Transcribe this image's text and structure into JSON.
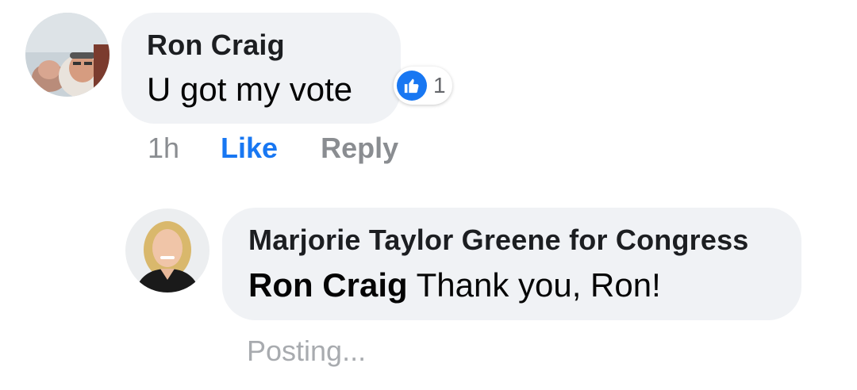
{
  "comments": [
    {
      "author": "Ron Craig",
      "text": "U got my vote",
      "reaction": {
        "icon": "thumbs-up-icon",
        "count": "1",
        "color": "#1877f2"
      },
      "actions": {
        "timestamp": "1h",
        "like_label": "Like",
        "reply_label": "Reply"
      }
    }
  ],
  "reply": {
    "author": "Marjorie Taylor Greene for Congress",
    "mention": "Ron Craig",
    "text": " Thank you, Ron!",
    "status": "Posting..."
  },
  "colors": {
    "bubble": "#f0f2f5",
    "like_blue": "#1877f2",
    "muted": "#8a8d91"
  }
}
